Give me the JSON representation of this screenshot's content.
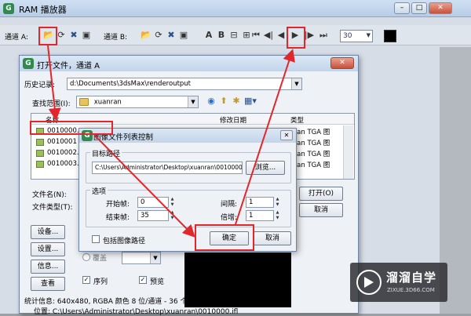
{
  "ram_player": {
    "title": "RAM 播放器",
    "controls": {
      "minimize": "–",
      "maximize": "□",
      "close": "✕"
    },
    "toolbar": {
      "channel_a": "通道 A:",
      "channel_b": "通道 B:",
      "fps_value": "30",
      "text_a": "A",
      "text_b": "B"
    }
  },
  "open_dialog": {
    "title": "打开文件，通道 A",
    "close": "✕",
    "history_label": "历史记录:",
    "history_value": "d:\\Documents\\3dsMax\\renderoutput",
    "look_in_label": "查找范围(I):",
    "look_in_value": "xuanran",
    "columns": {
      "name": "名称",
      "date": "修改日期",
      "type": "类型"
    },
    "files": [
      {
        "name": "0010000.",
        "type": "nkan TGA 图"
      },
      {
        "name": "0010001",
        "type": "nkan TGA 图"
      },
      {
        "name": "0010002.",
        "type": "nkan TGA 图"
      },
      {
        "name": "0010003.",
        "type": "nkan TGA 图"
      }
    ],
    "filename_label": "文件名(N):",
    "filetype_label": "文件类型(T):",
    "open_button": "打开(O)",
    "cancel_button": "取消",
    "side_buttons": {
      "setup": "设备...",
      "settings": "设置...",
      "info": "信息...",
      "view": "查看"
    },
    "radio_label": "覆盖",
    "sequence_label": "序列",
    "preview_label": "预览",
    "stats": "统计信息: 640x480, RGBA 颜色 8 位/通道 - 36 个帧",
    "location": "位置:  C:\\Users\\Administrator\\Desktop\\xuanran\\0010000.ifl"
  },
  "image_list_dialog": {
    "title": "图像文件列表控制",
    "close": "✕",
    "target_path_label": "目标路径",
    "target_path": "C:\\Users\\Administrator\\Desktop\\xuanran\\0010000.ifl",
    "browse_button": "浏览...",
    "options_label": "选项",
    "start_frame_label": "开始帧:",
    "start_frame": "0",
    "end_frame_label": "结束帧:",
    "end_frame": "35",
    "interval_label": "间隔:",
    "interval": "1",
    "multiplier_label": "倍增:",
    "multiplier": "1",
    "include_path_label": "包括图像路径",
    "ok_button": "确定",
    "cancel_button": "取消"
  },
  "watermark": {
    "brand": "溜溜自学",
    "url": "ZIXUE.3D66.COM"
  },
  "colors": {
    "annotation_red": "#e2262b",
    "title_bar": "#c3d5ea",
    "dialog_bg": "#eef1f6"
  }
}
